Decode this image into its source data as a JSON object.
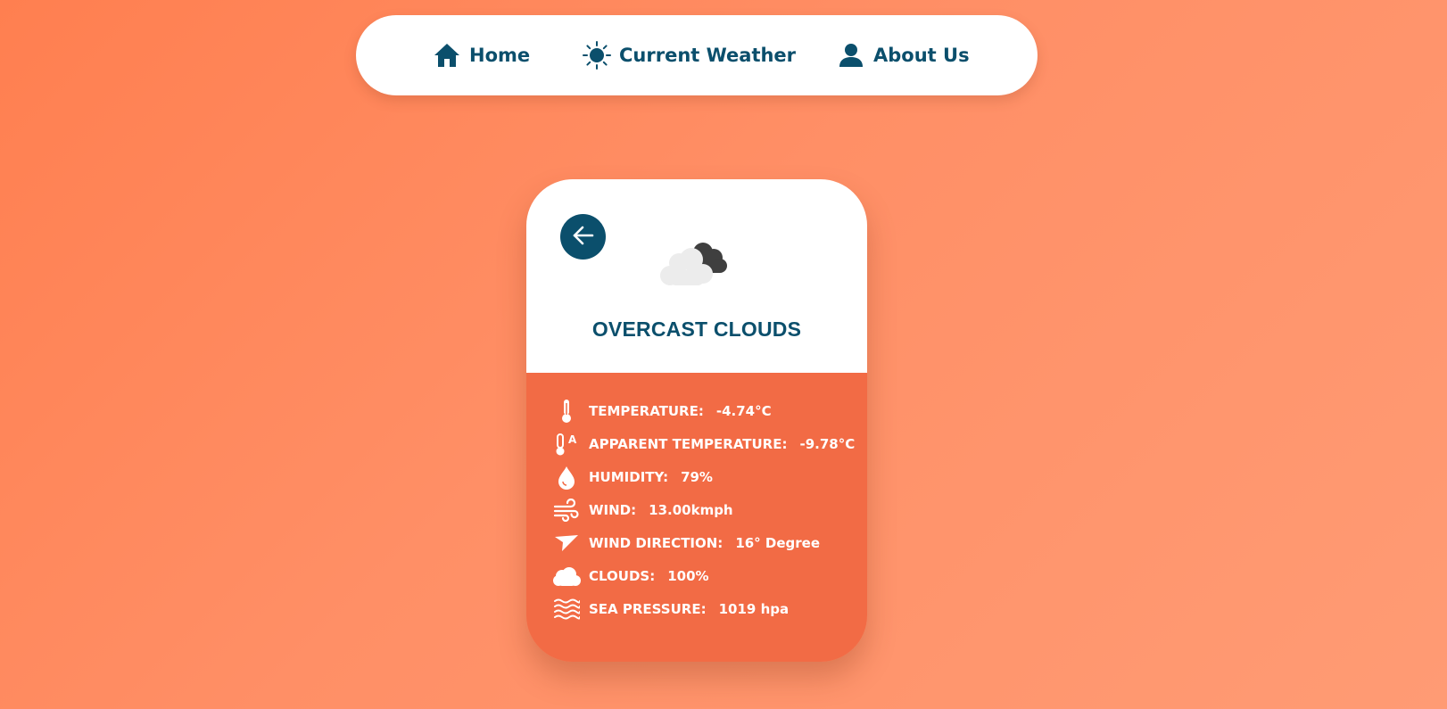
{
  "nav": {
    "items": [
      {
        "label": "Home",
        "icon": "home-icon"
      },
      {
        "label": "Current Weather",
        "icon": "sun-icon"
      },
      {
        "label": "About Us",
        "icon": "user-icon"
      }
    ]
  },
  "card": {
    "condition": "OVERCAST CLOUDS",
    "weather_icon": "overcast-clouds-icon",
    "back_icon": "arrow-left-icon",
    "stats": [
      {
        "label": "TEMPERATURE:",
        "value": "-4.74°C",
        "icon": "thermometer-icon"
      },
      {
        "label": "APPARENT TEMPERATURE:",
        "value": "-9.78°C",
        "icon": "apparent-temperature-icon"
      },
      {
        "label": "HUMIDITY:",
        "value": "79%",
        "icon": "droplet-icon"
      },
      {
        "label": "WIND:",
        "value": "13.00kmph",
        "icon": "wind-icon"
      },
      {
        "label": "WIND DIRECTION:",
        "value": "16° Degree",
        "icon": "direction-arrow-icon"
      },
      {
        "label": "CLOUDS:",
        "value": "100%",
        "icon": "cloud-icon"
      },
      {
        "label": "SEA PRESSURE:",
        "value": "1019 hpa",
        "icon": "waves-icon"
      }
    ]
  },
  "colors": {
    "accent": "#0b4f6c",
    "card_bottom": "#f26b45",
    "background": "#ff8a5f"
  }
}
